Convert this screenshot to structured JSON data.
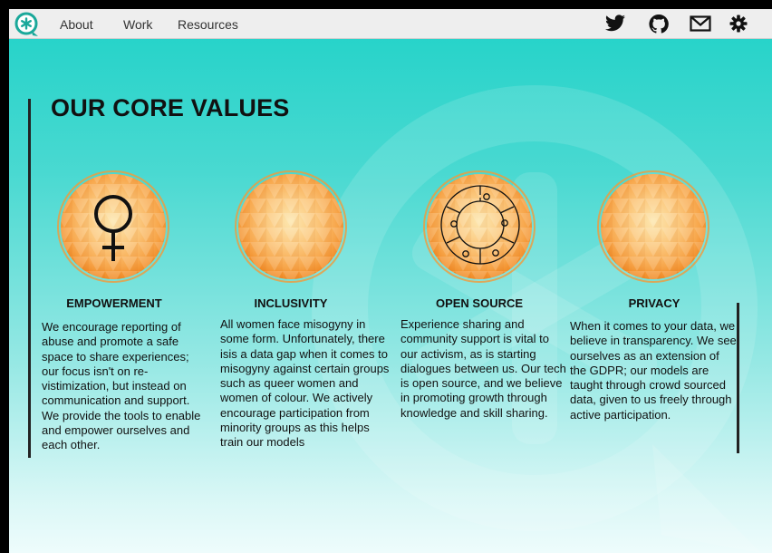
{
  "nav": {
    "links": [
      "About",
      "Work",
      "Resources"
    ],
    "icons": [
      "twitter-icon",
      "github-icon",
      "mail-icon",
      "settings-icon"
    ]
  },
  "colors": {
    "accent": "#1aa89a",
    "orb_orange": "#f7a34a",
    "background_top": "#20d2c8",
    "background_bottom": "#eefcfc"
  },
  "main": {
    "heading": "OUR CORE VALUES",
    "values": [
      {
        "title": "EMPOWERMENT",
        "icon": "venus-symbol-icon",
        "body": "We encourage reporting of abuse and promote a safe space to share experiences; our focus isn't on re-vistimization, but instead on communication and support. We provide the tools to enable and empower ourselves and each other."
      },
      {
        "title": "INCLUSIVITY",
        "icon": "none",
        "body": "All women face misogyny in some form. Unfortunately, there isis a data gap when it comes to misogyny against certain groups such as queer women and women of colour. We actively encourage participation from minority groups as this helps train our models"
      },
      {
        "title": "OPEN SOURCE",
        "icon": "puzzle-ring-icon",
        "body": "Experience sharing and community support is vital to our activism, as is starting dialogues between us. Our tech is open source, and we believe in promoting growth through knowledge and skill sharing."
      },
      {
        "title": "PRIVACY",
        "icon": "none",
        "body": "When it comes to your data, we believe in transparency. We see ourselves as an extension of the GDPR; our models are taught through crowd sourced data, given to us freely through active participation."
      }
    ]
  }
}
